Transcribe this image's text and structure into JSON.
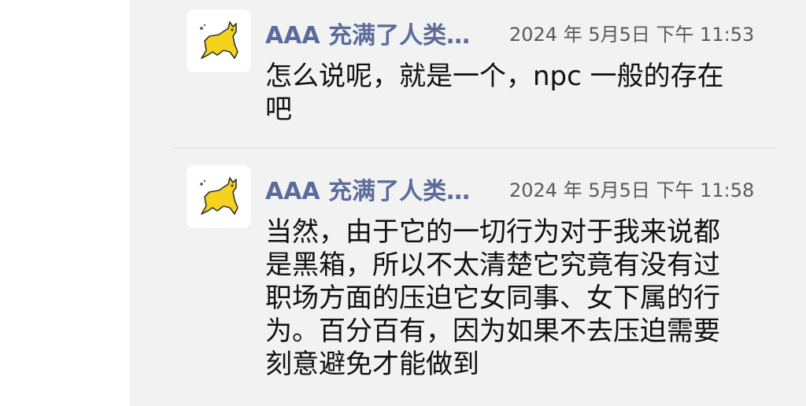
{
  "messages": [
    {
      "sender": "AAA 充满了人类…",
      "time": "2024 年 5月5日 下午 11:53",
      "text": "怎么说呢，就是一个，npc 一般的存在\n吧"
    },
    {
      "sender": "AAA 充满了人类…",
      "time": "2024 年 5月5日 下午 11:58",
      "text": "当然，由于它的一切行为对于我来说都\n是黑箱，所以不太清楚它究竟有没有过\n职场方面的压迫它女同事、女下属的行\n为。百分百有，因为如果不去压迫需要\n刻意避免才能做到"
    }
  ],
  "avatar_icon": "yellow-cat-icon",
  "colors": {
    "sender": "#5b6b9c",
    "background": "#f2f2f2"
  }
}
